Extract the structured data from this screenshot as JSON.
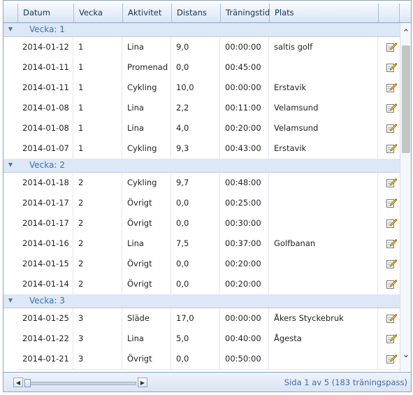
{
  "columns": [
    "Datum",
    "Vecka",
    "Aktivitet",
    "Distans",
    "Träningstid",
    "Plats"
  ],
  "groups": [
    {
      "label": "Vecka: 1",
      "rows": [
        {
          "datum": "2014-01-12",
          "vecka": "1",
          "aktivitet": "Lina",
          "distans": "9,0",
          "tid": "00:00:00",
          "plats": "saltis golf"
        },
        {
          "datum": "2014-01-11",
          "vecka": "1",
          "aktivitet": "Promenad",
          "distans": "0,0",
          "tid": "00:45:00",
          "plats": ""
        },
        {
          "datum": "2014-01-11",
          "vecka": "1",
          "aktivitet": "Cykling",
          "distans": "10,0",
          "tid": "00:00:00",
          "plats": "Erstavik"
        },
        {
          "datum": "2014-01-08",
          "vecka": "1",
          "aktivitet": "Lina",
          "distans": "2,2",
          "tid": "00:11:00",
          "plats": "Velamsund"
        },
        {
          "datum": "2014-01-08",
          "vecka": "1",
          "aktivitet": "Lina",
          "distans": "4,0",
          "tid": "00:20:00",
          "plats": "Velamsund"
        },
        {
          "datum": "2014-01-07",
          "vecka": "1",
          "aktivitet": "Cykling",
          "distans": "9,3",
          "tid": "00:43:00",
          "plats": "Erstavik"
        }
      ]
    },
    {
      "label": "Vecka: 2",
      "rows": [
        {
          "datum": "2014-01-18",
          "vecka": "2",
          "aktivitet": "Cykling",
          "distans": "9,7",
          "tid": "00:48:00",
          "plats": ""
        },
        {
          "datum": "2014-01-17",
          "vecka": "2",
          "aktivitet": "Övrigt",
          "distans": "0,0",
          "tid": "00:25:00",
          "plats": ""
        },
        {
          "datum": "2014-01-17",
          "vecka": "2",
          "aktivitet": "Övrigt",
          "distans": "0,0",
          "tid": "00:30:00",
          "plats": ""
        },
        {
          "datum": "2014-01-16",
          "vecka": "2",
          "aktivitet": "Lina",
          "distans": "7,5",
          "tid": "00:37:00",
          "plats": "Golfbanan"
        },
        {
          "datum": "2014-01-15",
          "vecka": "2",
          "aktivitet": "Övrigt",
          "distans": "0,0",
          "tid": "00:20:00",
          "plats": ""
        },
        {
          "datum": "2014-01-14",
          "vecka": "2",
          "aktivitet": "Övrigt",
          "distans": "0,0",
          "tid": "00:20:00",
          "plats": ""
        }
      ]
    },
    {
      "label": "Vecka: 3",
      "rows": [
        {
          "datum": "2014-01-25",
          "vecka": "3",
          "aktivitet": "Släde",
          "distans": "17,0",
          "tid": "00:00:00",
          "plats": "Åkers Styckebruk"
        },
        {
          "datum": "2014-01-22",
          "vecka": "3",
          "aktivitet": "Lina",
          "distans": "5,0",
          "tid": "00:40:00",
          "plats": "Ågesta"
        },
        {
          "datum": "2014-01-21",
          "vecka": "3",
          "aktivitet": "Övrigt",
          "distans": "0,0",
          "tid": "00:50:00",
          "plats": ""
        }
      ]
    }
  ],
  "pager": {
    "info": "Sida 1 av 5 (183 träningspass)"
  },
  "colors": {
    "group_text": "#3a6fb3",
    "header_bg": "#dbe6f4",
    "pager_text": "#3f6aa6"
  }
}
